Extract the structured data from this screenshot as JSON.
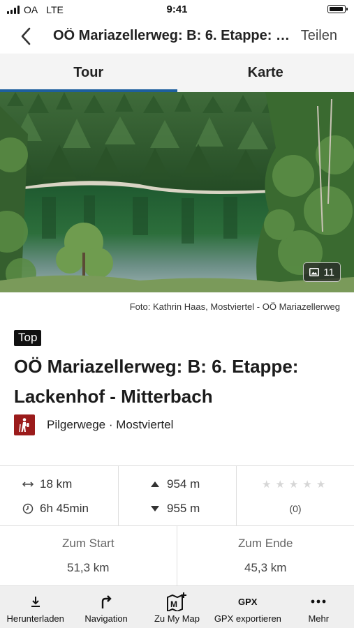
{
  "status_bar": {
    "carrier": "OA",
    "network": "LTE",
    "time": "9:41"
  },
  "header": {
    "title": "OÖ Mariazellerweg: B: 6. Etappe: Lackenhof - Mitterbach",
    "share_label": "Teilen",
    "back_icon": "chevron-left-icon"
  },
  "tabs": [
    {
      "label": "Tour",
      "active": true
    },
    {
      "label": "Karte",
      "active": false
    }
  ],
  "photo": {
    "image_count": "11",
    "credit": "Foto: Kathrin Haas, Mostviertel - OÖ Mariazellerweg"
  },
  "tour": {
    "badge": "Top",
    "title": "OÖ Mariazellerweg: B: 6. Etappe: Lackenhof - Mitterbach",
    "category": "Pilgerwege · Mostviertel",
    "category_icon": "hiker-icon",
    "category_color": "#9b1b1b"
  },
  "stats": {
    "distance": "18 km",
    "duration": "6h 45min",
    "ascent": "954 m",
    "descent": "955 m",
    "rating_stars": 0,
    "rating_max": 5,
    "rating_count": "(0)"
  },
  "distances": {
    "start_label": "Zum Start",
    "start_value": "51,3 km",
    "end_label": "Zum Ende",
    "end_value": "45,3 km"
  },
  "toolbar": [
    {
      "label": "Herunterladen",
      "icon": "download-icon"
    },
    {
      "label": "Navigation",
      "icon": "turn-right-arrow-icon"
    },
    {
      "label": "Zu My Map",
      "icon": "map-add-icon"
    },
    {
      "label": "GPX exportieren",
      "icon": "gpx-icon"
    },
    {
      "label": "Mehr",
      "icon": "more-dots-icon"
    }
  ],
  "colors": {
    "accent": "#1d5f9e",
    "tab_bg": "#f4f4f4",
    "toolbar_bg": "#efefef"
  }
}
